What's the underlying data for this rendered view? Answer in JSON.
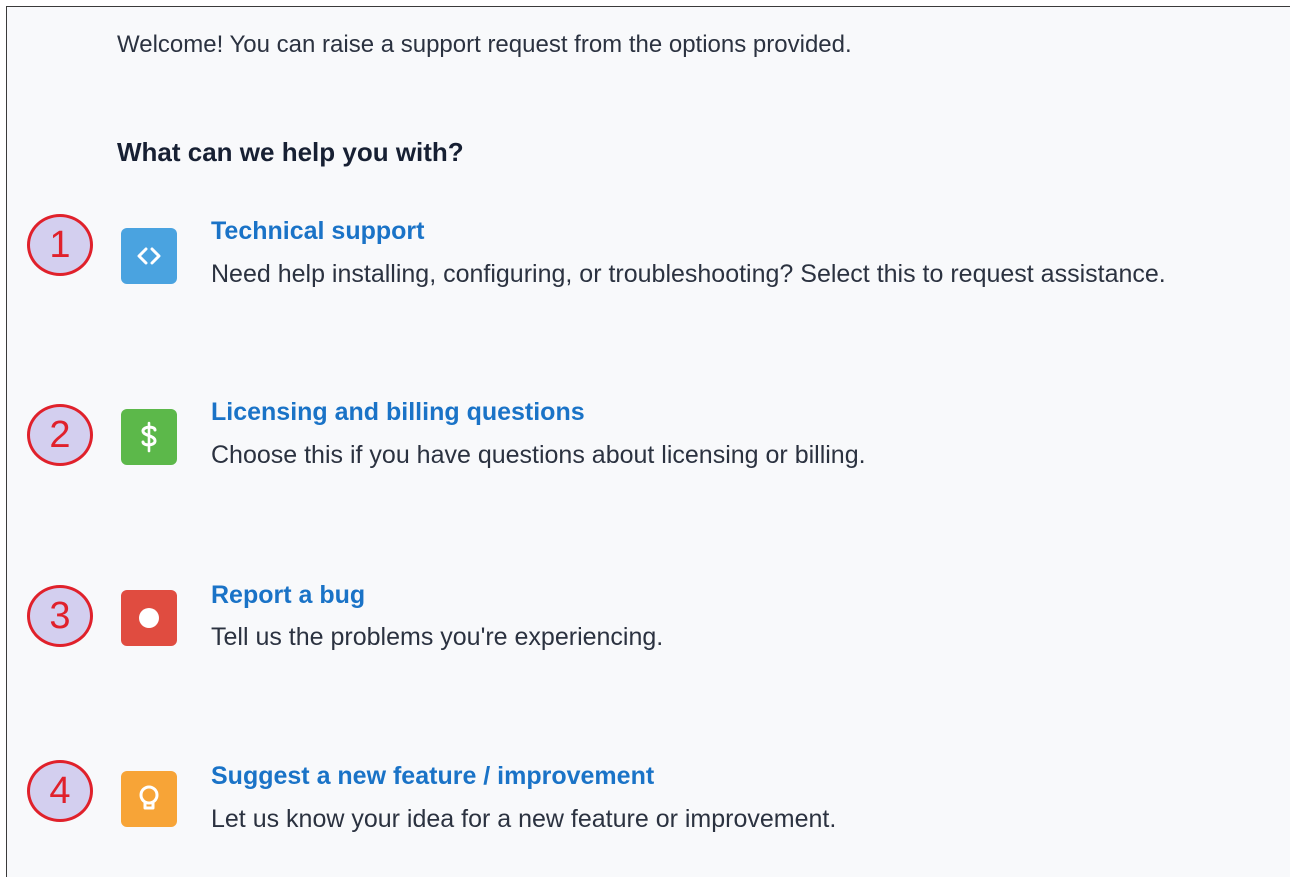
{
  "intro": {
    "welcome_text": "Welcome! You can raise a support request from the options provided.",
    "heading": "What can we help you with?"
  },
  "options": [
    {
      "marker": "1",
      "icon": "code-brackets-icon",
      "icon_color": "#4aa3e0",
      "title": "Technical support",
      "description": "Need help installing, configuring, or troubleshooting? Select this to request assistance."
    },
    {
      "marker": "2",
      "icon": "dollar-sign-icon",
      "icon_color": "#5cb84a",
      "title": "Licensing and billing questions",
      "description": "Choose this if you have questions about licensing or billing."
    },
    {
      "marker": "3",
      "icon": "stop-circle-icon",
      "icon_color": "#e04c40",
      "title": "Report a bug",
      "description": "Tell us the problems you're experiencing."
    },
    {
      "marker": "4",
      "icon": "lightbulb-icon",
      "icon_color": "#f7a437",
      "title": "Suggest a new feature / improvement",
      "description": "Let us know your idea for a new feature or improvement."
    }
  ],
  "colors": {
    "link": "#1a73c7",
    "text": "#2b3240",
    "heading": "#172033",
    "marker": "#e0212b",
    "marker_fill": "#d3cfef"
  }
}
